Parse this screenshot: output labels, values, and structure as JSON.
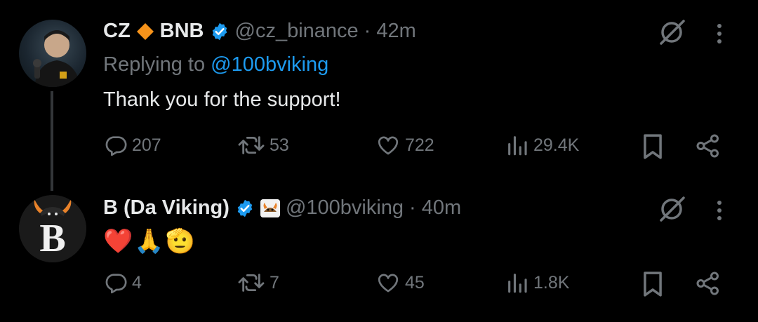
{
  "tweets": [
    {
      "name": "CZ",
      "name_suffix": "BNB",
      "handle": "@cz_binance",
      "separator": "·",
      "time": "42m",
      "replying_prefix": "Replying to",
      "replying_handle": "@100bviking",
      "text": "Thank you for the support!",
      "replies": "207",
      "retweets": "53",
      "likes": "722",
      "views": "29.4K"
    },
    {
      "name": "B (Da Viking)",
      "handle": "@100bviking",
      "separator": "·",
      "time": "40m",
      "text": "❤️🙏🫡",
      "replies": "4",
      "retweets": "7",
      "likes": "45",
      "views": "1.8K",
      "avatar_letter": "B"
    }
  ],
  "colors": {
    "background": "#000000",
    "text": "#e7e9ea",
    "muted": "#71767b",
    "link": "#1d9bf0",
    "verified": "#1d9bf0",
    "diamond": "#f7931a"
  }
}
